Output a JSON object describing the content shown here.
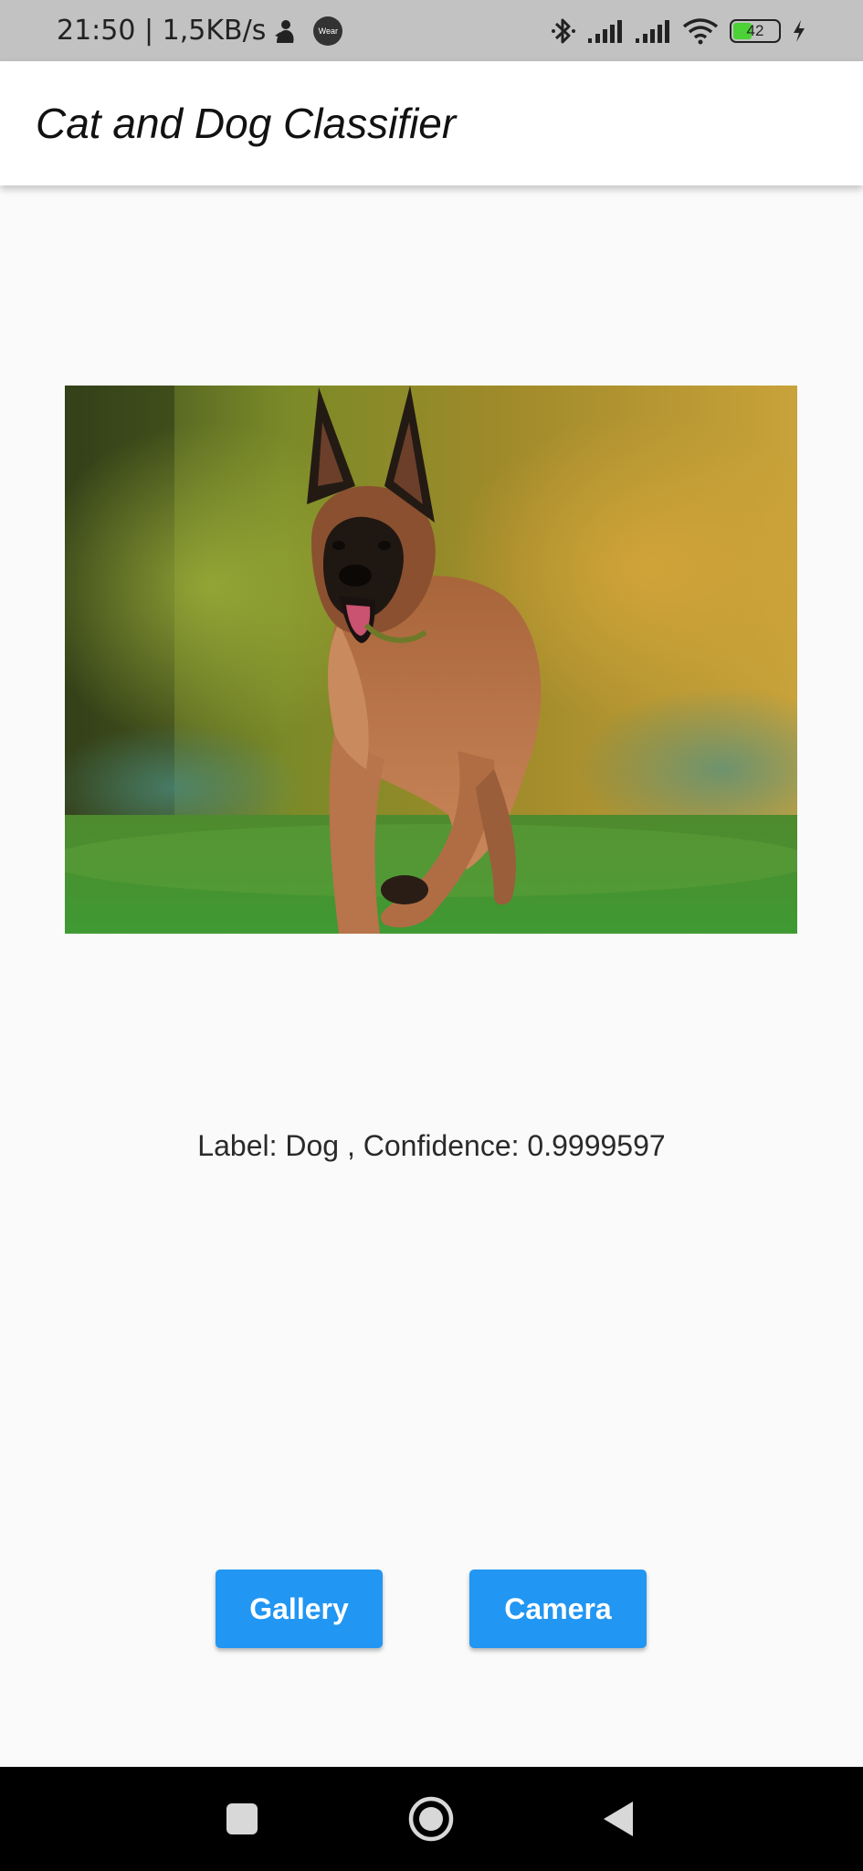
{
  "status_bar": {
    "time_speed": "21:50 | 1,5KB/s",
    "wear_label": "Wear",
    "battery": "42",
    "icons": [
      "notification-icon",
      "wear-icon",
      "bluetooth-icon",
      "signal-icon",
      "signal-icon",
      "wifi-icon",
      "battery-icon",
      "charging-icon"
    ]
  },
  "app_bar": {
    "title": "Cat and Dog Classifier"
  },
  "result": {
    "text": "Label: Dog , Confidence: 0.9999597"
  },
  "buttons": {
    "gallery_label": "Gallery",
    "camera_label": "Camera"
  },
  "nav_bar": {
    "icons": [
      "recents-square-icon",
      "home-circle-icon",
      "back-triangle-icon"
    ]
  },
  "colors": {
    "status_bar_bg": "#c2c2c2",
    "app_bar_bg": "#ffffff",
    "page_bg": "#fafafa",
    "accent": "#2196f3",
    "nav_bar_bg": "#000000"
  }
}
